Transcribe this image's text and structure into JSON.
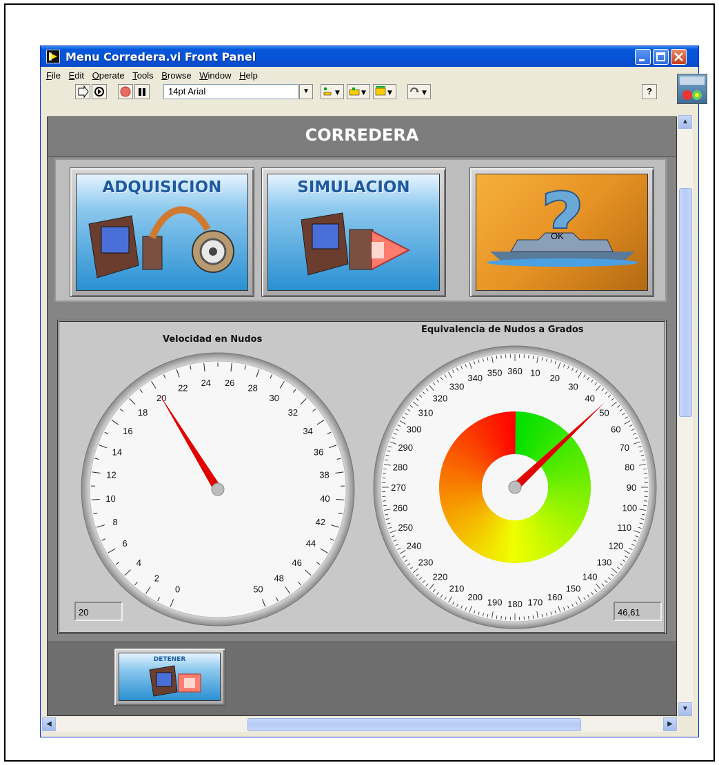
{
  "window": {
    "title": "Menu Corredera.vi Front Panel",
    "accent": "#0758dc"
  },
  "menu": [
    "File",
    "Edit",
    "Operate",
    "Tools",
    "Browse",
    "Window",
    "Help"
  ],
  "toolbar": {
    "font_select": "14pt Arial",
    "icons": [
      "run-arrow-icon",
      "run-continuous-icon",
      "abort-icon",
      "pause-icon",
      "align-icon",
      "distribute-icon",
      "resize-icon",
      "reorder-icon",
      "help-icon"
    ],
    "help_label": "?"
  },
  "panel": {
    "title": "CORREDERA",
    "buttons": [
      {
        "label": "ADQUISICION",
        "icon": "acquisition-computer-icon"
      },
      {
        "label": "SIMULACION",
        "icon": "simulation-computer-icon"
      },
      {
        "label": "",
        "icon": "ship-question-help-icon",
        "overlay": "OK"
      }
    ],
    "stop_button": {
      "label": "DETENER",
      "icon": "stop-computer-icon"
    }
  },
  "gauges": {
    "speed": {
      "title": "Velocidad en Nudos",
      "min": 0,
      "max": 50,
      "value": 20,
      "readout": "20",
      "tick_labels": [
        "0",
        "2",
        "4",
        "6",
        "8",
        "10",
        "12",
        "14",
        "16",
        "18",
        "20",
        "22",
        "24",
        "26",
        "28",
        "30",
        "32",
        "34",
        "36",
        "38",
        "40",
        "42",
        "44",
        "46",
        "48",
        "50"
      ],
      "needle_color": "#e00000"
    },
    "degrees": {
      "title": "Equivalencia de Nudos a Grados",
      "min": 0,
      "max": 360,
      "value": 46.61,
      "readout": "46,61",
      "tick_labels": [
        "10",
        "20",
        "30",
        "40",
        "50",
        "60",
        "70",
        "80",
        "90",
        "100",
        "110",
        "120",
        "130",
        "140",
        "150",
        "160",
        "170",
        "180",
        "190",
        "200",
        "210",
        "220",
        "230",
        "240",
        "250",
        "260",
        "270",
        "280",
        "290",
        "300",
        "310",
        "320",
        "330",
        "340",
        "350",
        "360"
      ],
      "ring_colors": [
        "#00e000",
        "#e8ff00",
        "#ff0000"
      ],
      "needle_color": "#e00000"
    }
  }
}
